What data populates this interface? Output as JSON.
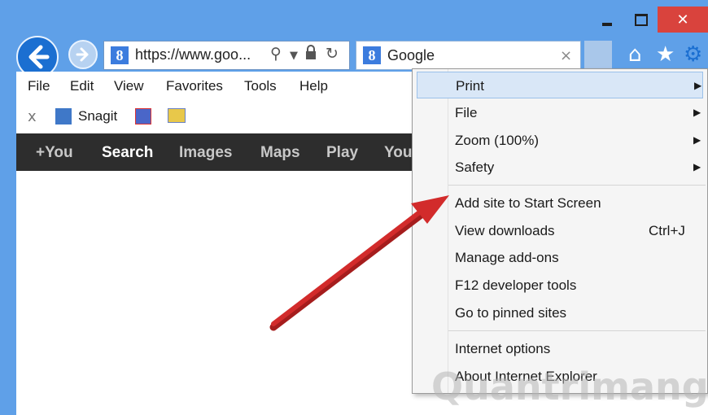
{
  "window": {
    "controls": {
      "minimize": "minimize-icon",
      "maximize": "maximize-icon",
      "close": "close-icon"
    }
  },
  "address_bar": {
    "url": "https://www.goo...",
    "icons": [
      "search-icon",
      "dropdown-icon",
      "lock-icon",
      "refresh-icon"
    ]
  },
  "tab": {
    "title": "Google",
    "close_icon": "close-icon"
  },
  "toolbar_icons": [
    "home-icon",
    "star-icon",
    "gear-icon"
  ],
  "menu_bar": {
    "items": [
      "File",
      "Edit",
      "View",
      "Favorites",
      "Tools",
      "Help"
    ]
  },
  "favorites_bar": {
    "close": "x",
    "items": [
      {
        "label": "Snagit"
      }
    ]
  },
  "google_bar": {
    "items": [
      "+You",
      "Search",
      "Images",
      "Maps",
      "Play",
      "You"
    ]
  },
  "tools_menu": {
    "items": [
      {
        "label": "Print",
        "submenu": true,
        "highlighted": true
      },
      {
        "label": "File",
        "submenu": true
      },
      {
        "label": "Zoom (100%)",
        "submenu": true
      },
      {
        "label": "Safety",
        "submenu": true
      },
      {
        "label": "Add site to Start Screen"
      },
      {
        "label": "View downloads",
        "shortcut": "Ctrl+J"
      },
      {
        "label": "Manage add-ons"
      },
      {
        "label": "F12 developer tools"
      },
      {
        "label": "Go to pinned sites"
      },
      {
        "label": "Internet options"
      },
      {
        "label": "About Internet Explorer"
      }
    ]
  },
  "annotation": {
    "color": "#d22b2b"
  },
  "watermark": "Quantrimang",
  "colors": {
    "titlebar": "#5fa0e8",
    "close": "#d9433d",
    "back": "#1b6fd1",
    "highlight": "#d9e7f7"
  }
}
